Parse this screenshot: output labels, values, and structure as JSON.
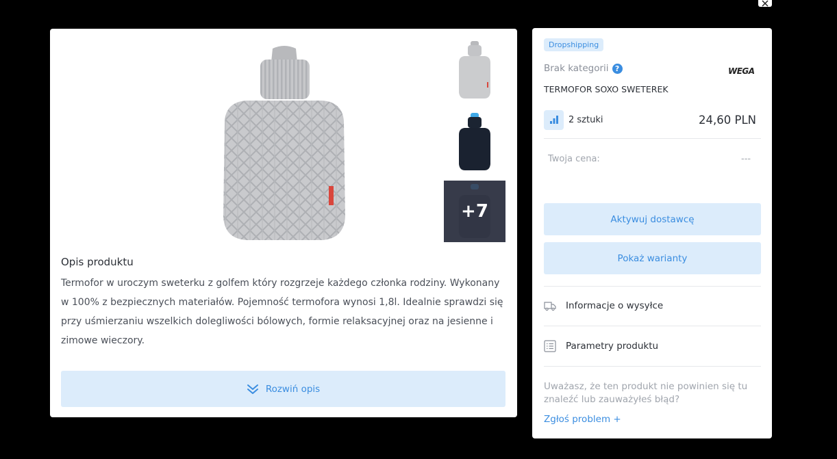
{
  "gallery": {
    "more_count": "+7"
  },
  "description": {
    "title": "Opis produktu",
    "text": "Termofor w uroczym sweterku z golfem który rozgrzeje każdego członka rodziny. Wykonany w 100% z bezpiecznych materiałów. Pojemność termofora wynosi 1,8l. Idealnie sprawdzi się przy uśmierzaniu wszelkich dolegliwości bólowych, formie relaksacyjnej oraz na jesienne i zimowe wieczory.",
    "expand_label": "Rozwiń opis"
  },
  "product": {
    "badge": "Dropshipping",
    "category": "Brak kategorii",
    "brand": "WEGA",
    "name": "TERMOFOR SOXO SWETEREK",
    "stock": "2 sztuki",
    "price": "24,60 PLN",
    "your_price_label": "Twoja cena:",
    "your_price_value": "---"
  },
  "actions": {
    "activate_supplier": "Aktywuj dostawcę",
    "show_variants": "Pokaż warianty"
  },
  "info": {
    "shipping": "Informacje o wysyłce",
    "parameters": "Parametry produktu"
  },
  "report": {
    "text": "Uważasz, że ten produkt nie powinien się tu znaleźć lub zauważyłeś błąd?",
    "link": "Zgłoś problem +"
  },
  "colors": {
    "accent": "#3a8de0",
    "accent_bg": "#dcecfb",
    "backdrop": "#000000"
  }
}
